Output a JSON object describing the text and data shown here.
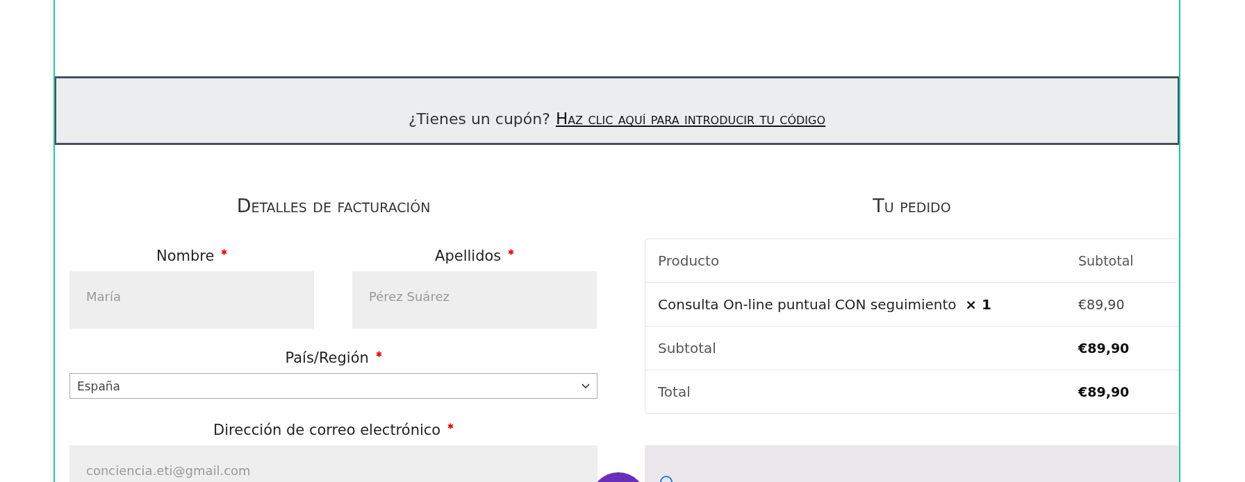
{
  "coupon": {
    "question": "¿Tienes un cupón?",
    "link": "Haz clic aquí para introducir tu código"
  },
  "billing": {
    "heading": "Detalles de facturación",
    "fields": [
      {
        "kind": "text",
        "label": "Nombre",
        "required": true,
        "placeholder": "María",
        "half": true
      },
      {
        "kind": "text",
        "label": "Apellidos",
        "required": true,
        "placeholder": "Pérez Suárez",
        "half": true
      },
      {
        "kind": "select",
        "label": "País/Región",
        "required": true,
        "value": "España",
        "half": false
      },
      {
        "kind": "text",
        "label": "Dirección de correo electrónico",
        "required": true,
        "placeholder": "conciencia.eti@gmail.com",
        "half": false
      }
    ]
  },
  "order": {
    "heading": "Tu pedido",
    "columns": [
      "Producto",
      "Subtotal"
    ],
    "items": [
      {
        "name": "Consulta On-line puntual CON seguimiento",
        "quantity": "× 1",
        "price": "€89,90"
      }
    ],
    "totals": [
      {
        "label": "Subtotal",
        "value": "€89,90"
      },
      {
        "label": "Total",
        "value": "€89,90"
      }
    ]
  }
}
